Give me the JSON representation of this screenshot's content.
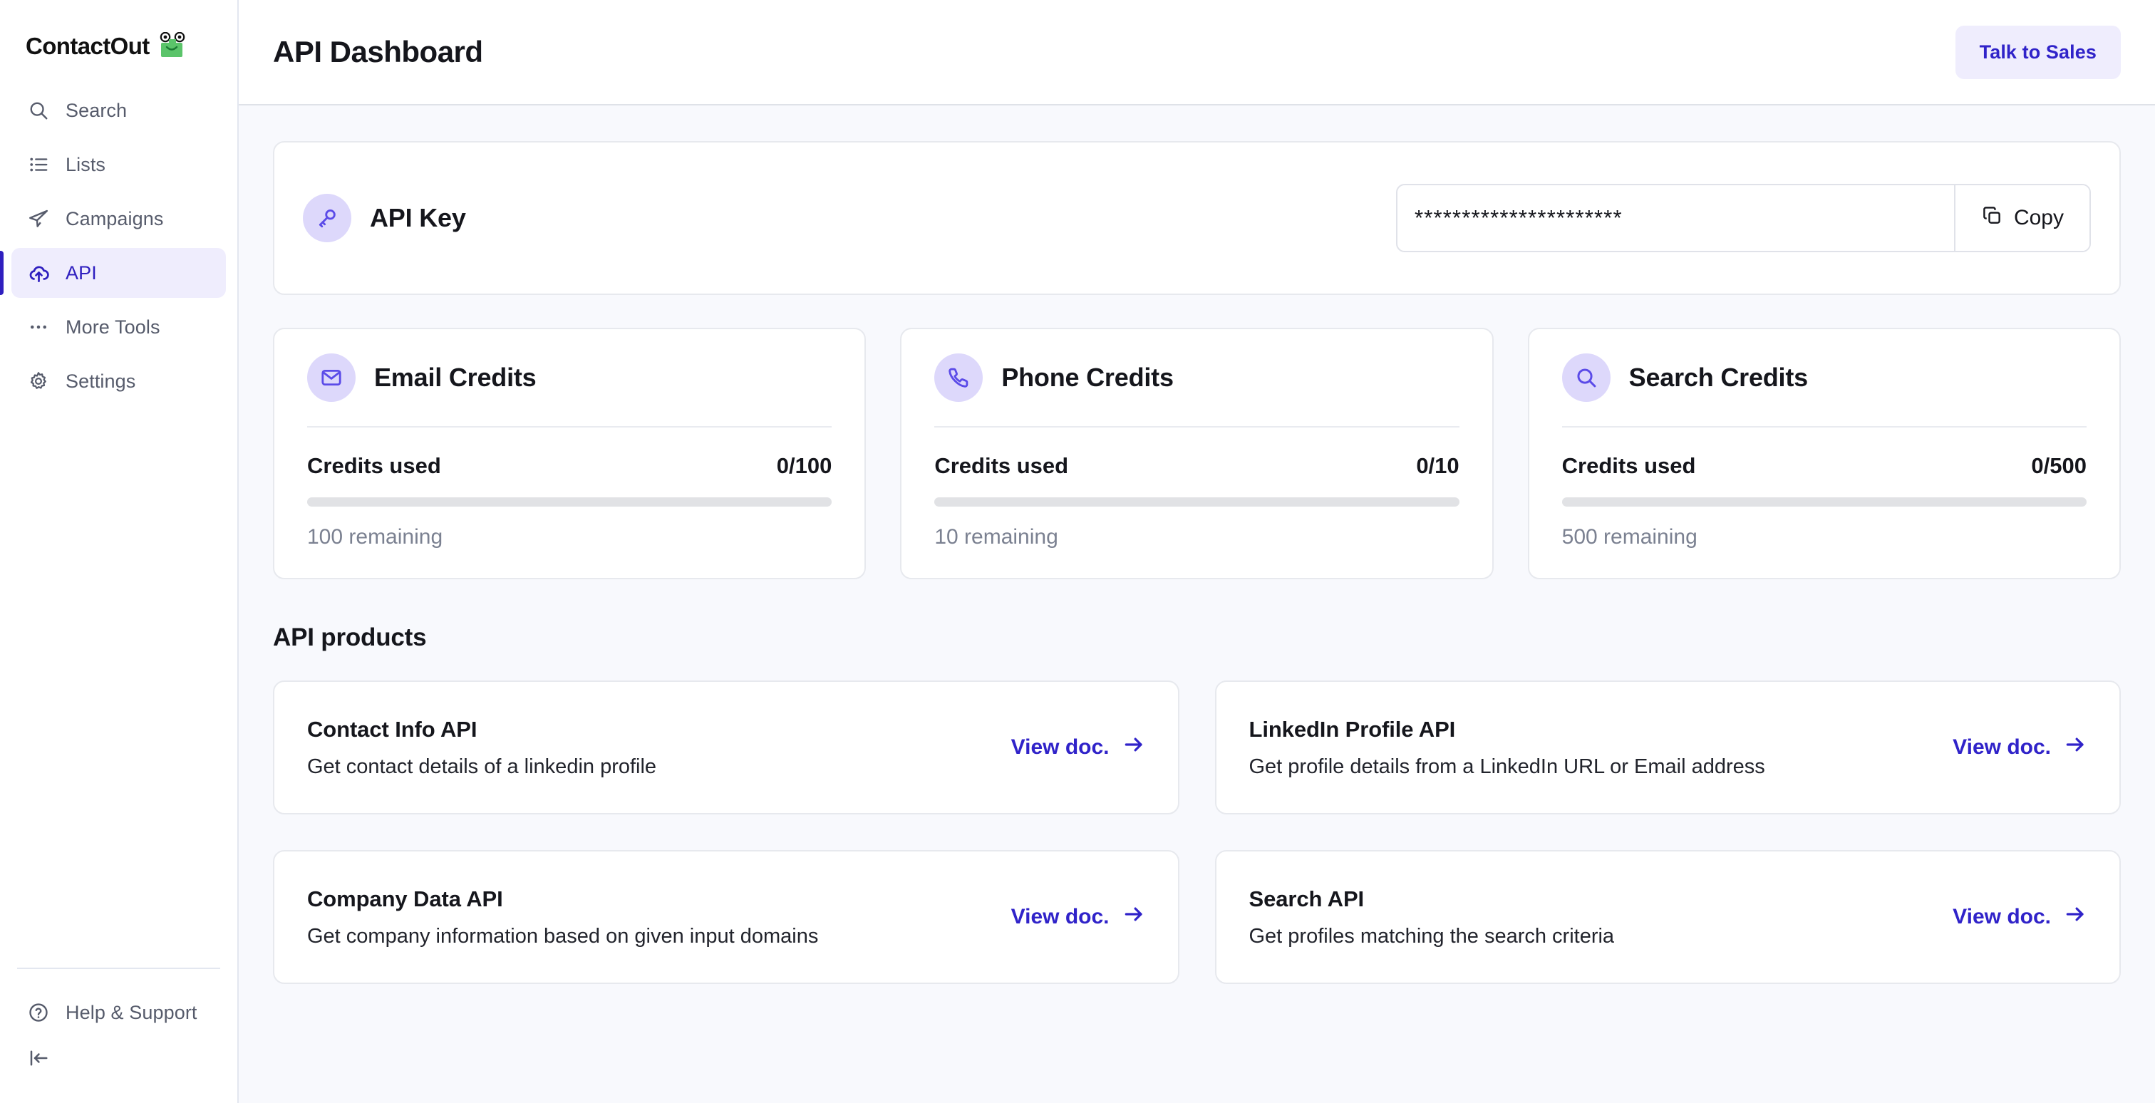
{
  "brand": {
    "name": "ContactOut",
    "logo_icon": "contactout-frog-logo"
  },
  "sidebar": {
    "items": [
      {
        "label": "Search",
        "icon": "search-icon",
        "active": false
      },
      {
        "label": "Lists",
        "icon": "list-icon",
        "active": false
      },
      {
        "label": "Campaigns",
        "icon": "paper-plane-icon",
        "active": false
      },
      {
        "label": "API",
        "icon": "cloud-upload-icon",
        "active": true
      },
      {
        "label": "More Tools",
        "icon": "ellipsis-icon",
        "active": false
      },
      {
        "label": "Settings",
        "icon": "gear-icon",
        "active": false
      }
    ],
    "help": {
      "label": "Help & Support",
      "icon": "question-circle-icon"
    },
    "collapse": {
      "icon": "collapse-sidebar-icon"
    }
  },
  "header": {
    "title": "API Dashboard",
    "talk_to_sales": "Talk to Sales"
  },
  "api_key_card": {
    "title": "API Key",
    "icon": "key-icon",
    "value": "**********************",
    "placeholder": "",
    "copy_label": "Copy",
    "copy_icon": "copy-icon"
  },
  "credit_cards": [
    {
      "title": "Email Credits",
      "icon": "envelope-icon",
      "used_label": "Credits used",
      "used_value": "0/100",
      "remaining": "100 remaining",
      "percent": 0
    },
    {
      "title": "Phone Credits",
      "icon": "phone-icon",
      "used_label": "Credits used",
      "used_value": "0/10",
      "remaining": "10 remaining",
      "percent": 0
    },
    {
      "title": "Search Credits",
      "icon": "search-icon",
      "used_label": "Credits used",
      "used_value": "0/500",
      "remaining": "500 remaining",
      "percent": 0
    }
  ],
  "products_section": {
    "title": "API products",
    "link_label": "View doc.",
    "link_icon": "arrow-right-icon",
    "items": [
      {
        "name": "Contact Info API",
        "desc": "Get contact details of a linkedin profile"
      },
      {
        "name": "LinkedIn Profile API",
        "desc": "Get profile details from a LinkedIn URL or Email address"
      },
      {
        "name": "Company Data API",
        "desc": "Get company information based on given input domains"
      },
      {
        "name": "Search API",
        "desc": "Get profiles matching the search criteria"
      }
    ]
  },
  "colors": {
    "accent_indigo": "#3023c9",
    "accent_soft": "#efedfd",
    "badge_lavender": "#ddd8fb",
    "page_bg": "#f8f9fd",
    "logo_green": "#5bc46a"
  }
}
